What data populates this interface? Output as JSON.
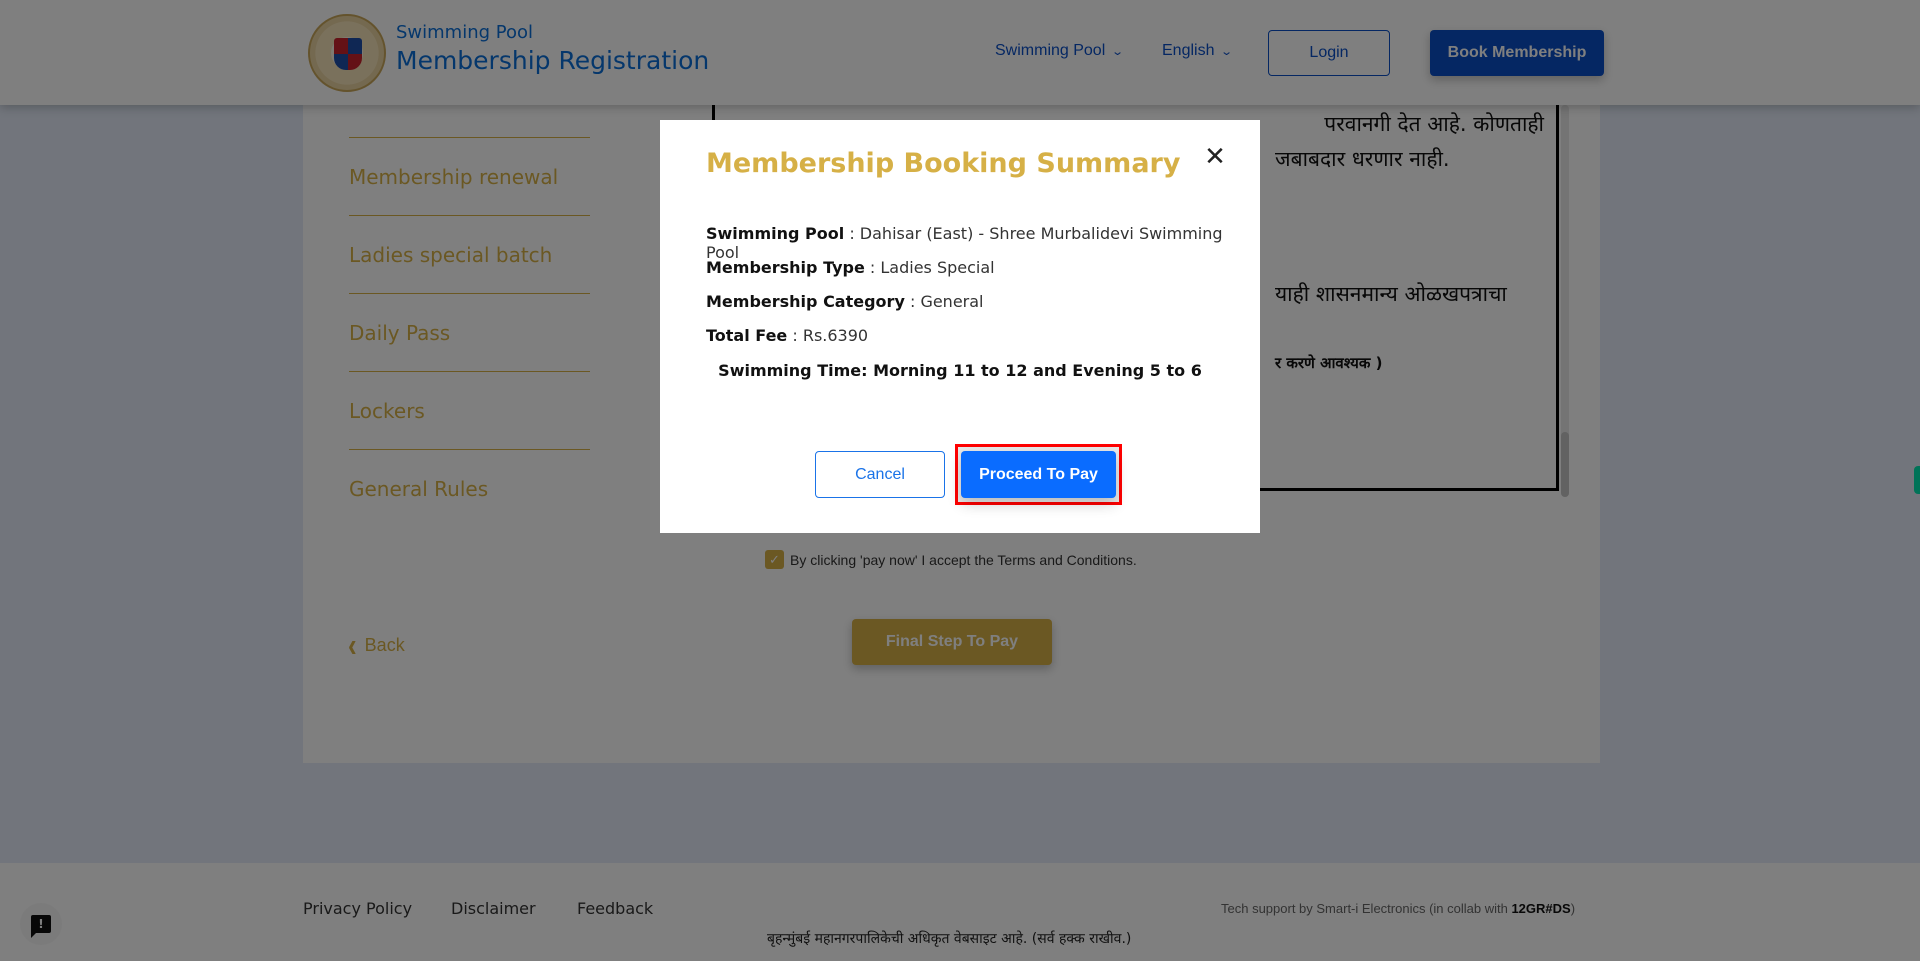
{
  "header": {
    "brand_subtitle": "Swimming Pool",
    "brand_title": "Membership Registration",
    "nav": {
      "swimming_pool_dropdown": "Swimming Pool",
      "language_dropdown": "English",
      "login_label": "Login",
      "book_membership_label": "Book Membership"
    }
  },
  "sidebar": {
    "items": [
      {
        "label": "Membership renewal"
      },
      {
        "label": "Ladies special batch"
      },
      {
        "label": "Daily Pass"
      },
      {
        "label": "Lockers"
      },
      {
        "label": "General Rules"
      }
    ]
  },
  "rules": {
    "lines": [
      "परवानगी देत आहे. कोणताही",
      "जबाबदार धरणार नाही.",
      "याही शासनमान्य ओळखपत्राचा",
      "र करणे आवश्यक )"
    ]
  },
  "form": {
    "terms_text": "By clicking 'pay now' I accept the Terms and Conditions.",
    "terms_checked": true,
    "back_label": "Back",
    "final_step_label": "Final Step To Pay"
  },
  "modal": {
    "title": "Membership Booking Summary",
    "rows": [
      {
        "label": "Swimming Pool",
        "value": "Dahisar (East) - Shree Murbalidevi Swimming Pool"
      },
      {
        "label": "Membership Type",
        "value": "Ladies Special"
      },
      {
        "label": "Membership Category",
        "value": "General"
      },
      {
        "label": "Total Fee",
        "value": "Rs.6390"
      }
    ],
    "separator": " : ",
    "swimming_time": "Swimming Time: Morning 11 to 12 and Evening 5 to 6",
    "cancel_label": "Cancel",
    "proceed_label": "Proceed To Pay"
  },
  "footer": {
    "links": [
      {
        "label": "Privacy Policy"
      },
      {
        "label": "Disclaimer"
      },
      {
        "label": "Feedback"
      }
    ],
    "tech_support_prefix": "Tech support by Smart-i Electronics (in collab with ",
    "tech_support_brand": "12GR#DS",
    "tech_support_suffix": ")",
    "copyright": "बृहन्मुंबई महानगरपालिकेची अधिकृत वेबसाइट आहे. (सर्व हक्क राखीव.)"
  },
  "icons": {
    "chevron_down": "⌄",
    "chevron_left": "‹",
    "close": "✕",
    "check": "✓",
    "feedback": "!"
  },
  "colors": {
    "brand_blue": "#0a4fc7",
    "gold_accent": "#d6b046",
    "proceed_blue": "#0a6cff",
    "highlight_red": "#ff0000"
  }
}
